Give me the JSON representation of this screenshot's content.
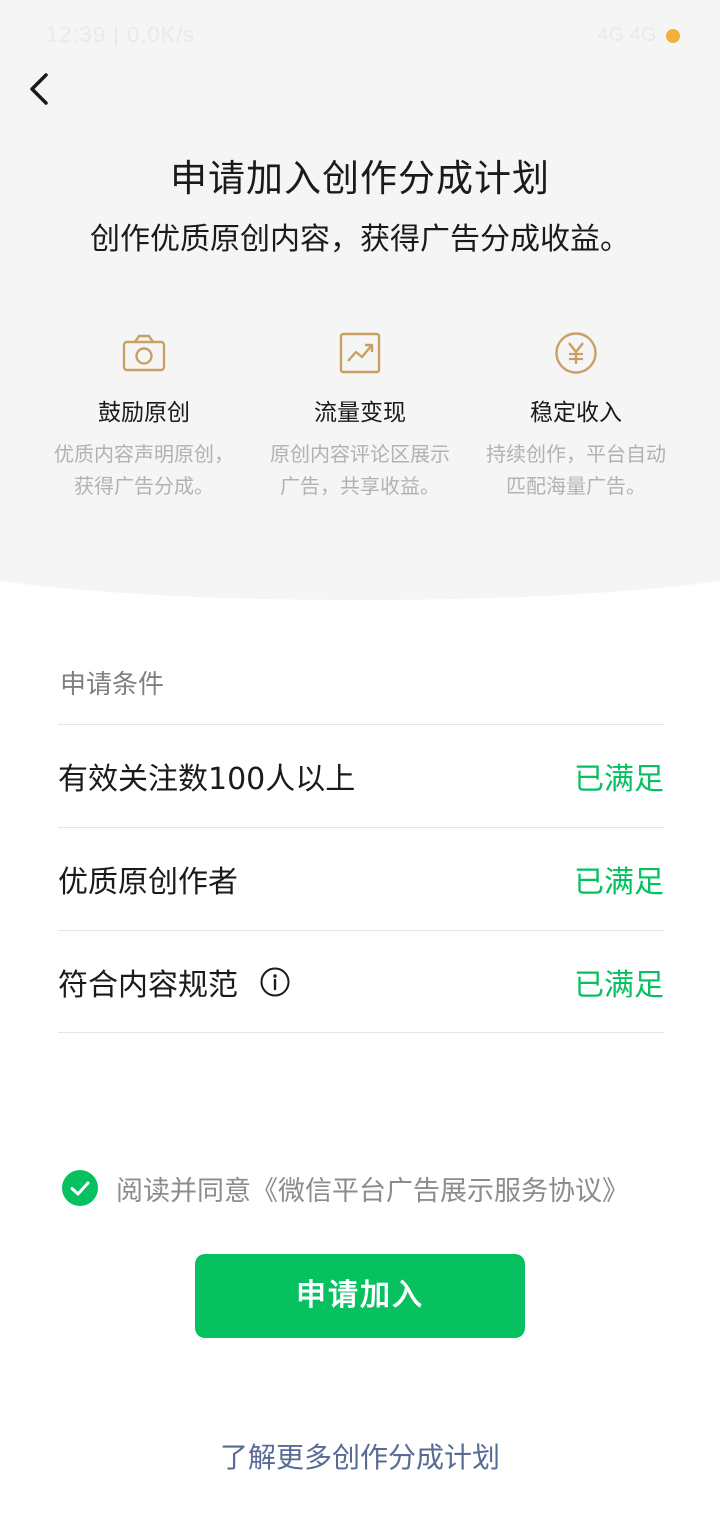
{
  "status_bar": {
    "time": "12:39 | 0.0K/s",
    "icons": "4G 4G"
  },
  "header": {
    "title": "申请加入创作分成计划",
    "subtitle": "创作优质原创内容，获得广告分成收益。"
  },
  "features": [
    {
      "icon": "camera-icon",
      "title": "鼓励原创",
      "desc": "优质内容声明原创，\n获得广告分成。"
    },
    {
      "icon": "trend-chart-icon",
      "title": "流量变现",
      "desc": "原创内容评论区展示\n广告，共享收益。"
    },
    {
      "icon": "yuan-coin-icon",
      "title": "稳定收入",
      "desc": "持续创作，平台自动\n匹配海量广告。"
    }
  ],
  "conditions": {
    "title": "申请条件",
    "items": [
      {
        "label": "有效关注数100人以上",
        "status": "已满足"
      },
      {
        "label": "优质原创作者",
        "status": "已满足"
      },
      {
        "label": "符合内容规范",
        "status": "已满足"
      }
    ]
  },
  "agreement": {
    "prefix": "阅读并同意",
    "link": "《微信平台广告展示服务协议》",
    "checked": true
  },
  "apply_button": "申请加入",
  "learn_more": "了解更多创作分成计划",
  "colors": {
    "accent": "#07c160",
    "icon_gold": "#c9a063",
    "link": "#576b95"
  }
}
